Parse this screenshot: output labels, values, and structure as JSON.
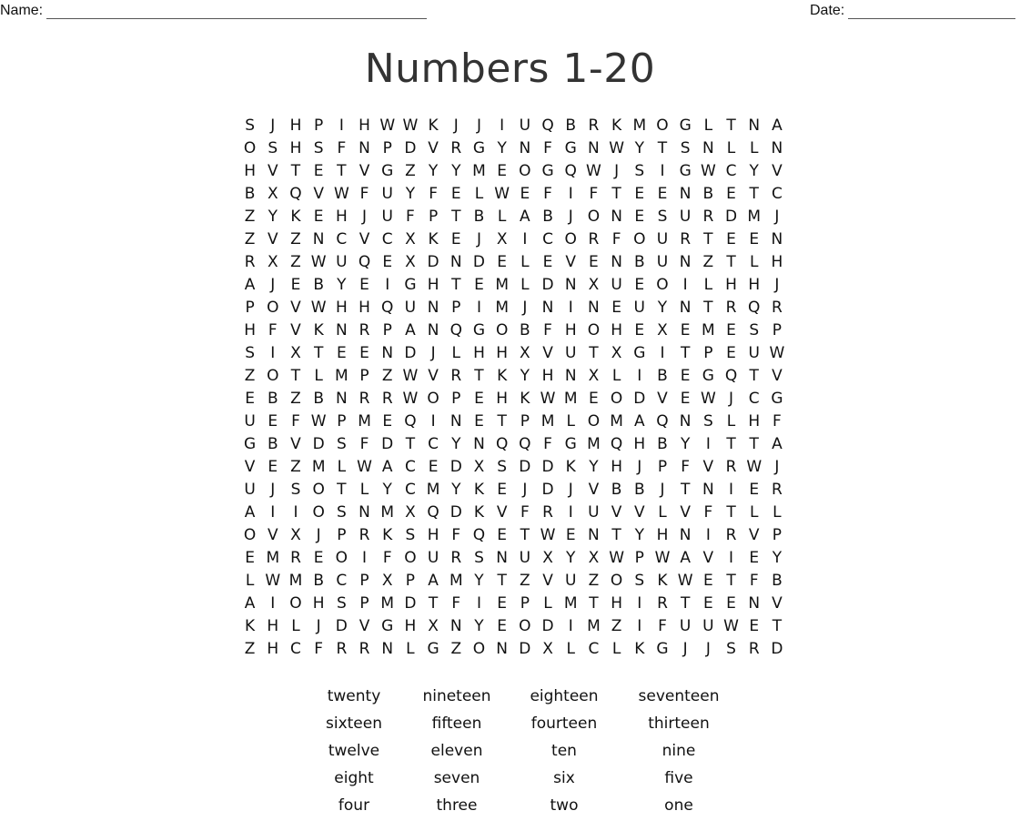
{
  "header": {
    "name_label": "Name:",
    "date_label": "Date:"
  },
  "title": "Numbers 1-20",
  "grid": [
    "SJHPIHWWKJJIUQBRKMOGLTNA",
    "OSHSFNPDVRGYNFGNWYTSNLLN",
    "HVTETVGZYYMEOGQWJSIGWCYV",
    "BXQVWFUYFELWEFIFTEENBETC",
    "ZYKEHJUFPTBLABJONESURDMJ",
    "ZVZNCVCXKEJXICORFOURTEEN",
    "RXZWUQEXDNDELEVENBUNZTLH",
    "AJEBYEIGHTEMLDNXUEOILHHJ",
    "POVWHHQUNPIMJNINEUYNTRQR",
    "HFVKNRPANQGOBFHOHEXEMESP",
    "SIXTEENDJLHHXVUTXGITPEUW",
    "ZOTLMPZWVRTKYHNXLIBEGQTV",
    "EBZBNRRWOPEHKWMEODVEWJCG",
    "UEFWPMEQINETPMLOMAQNSLHF",
    "GBVDSFDTCYNQQFGMQHBYITTA",
    "VEZMLWACEDXSDDKYHJPFVRWJ",
    "UJSOTLYCMYKEJDJVBBJTNIER",
    "AIIOSNMXQDKVFRIUVVLVFTLL",
    "OVXJPRKSHFQETWENTYHNIRVP",
    "EMREOIFOURSNUXYXWPWAVIEY",
    "LWMBCPXPAMYTZVUZOSKWETFB",
    "AIOHSPMDTFIEPLMTHIRTEENV",
    "KHLJDVGHXNYEODIMZIFUUWET",
    "ZHCFRRNLGZONDXLCLKGJJSRD"
  ],
  "word_list": [
    [
      "twenty",
      "nineteen",
      "eighteen",
      "seventeen"
    ],
    [
      "sixteen",
      "fifteen",
      "fourteen",
      "thirteen"
    ],
    [
      "twelve",
      "eleven",
      "ten",
      "nine"
    ],
    [
      "eight",
      "seven",
      "six",
      "five"
    ],
    [
      "four",
      "three",
      "two",
      "one"
    ]
  ]
}
